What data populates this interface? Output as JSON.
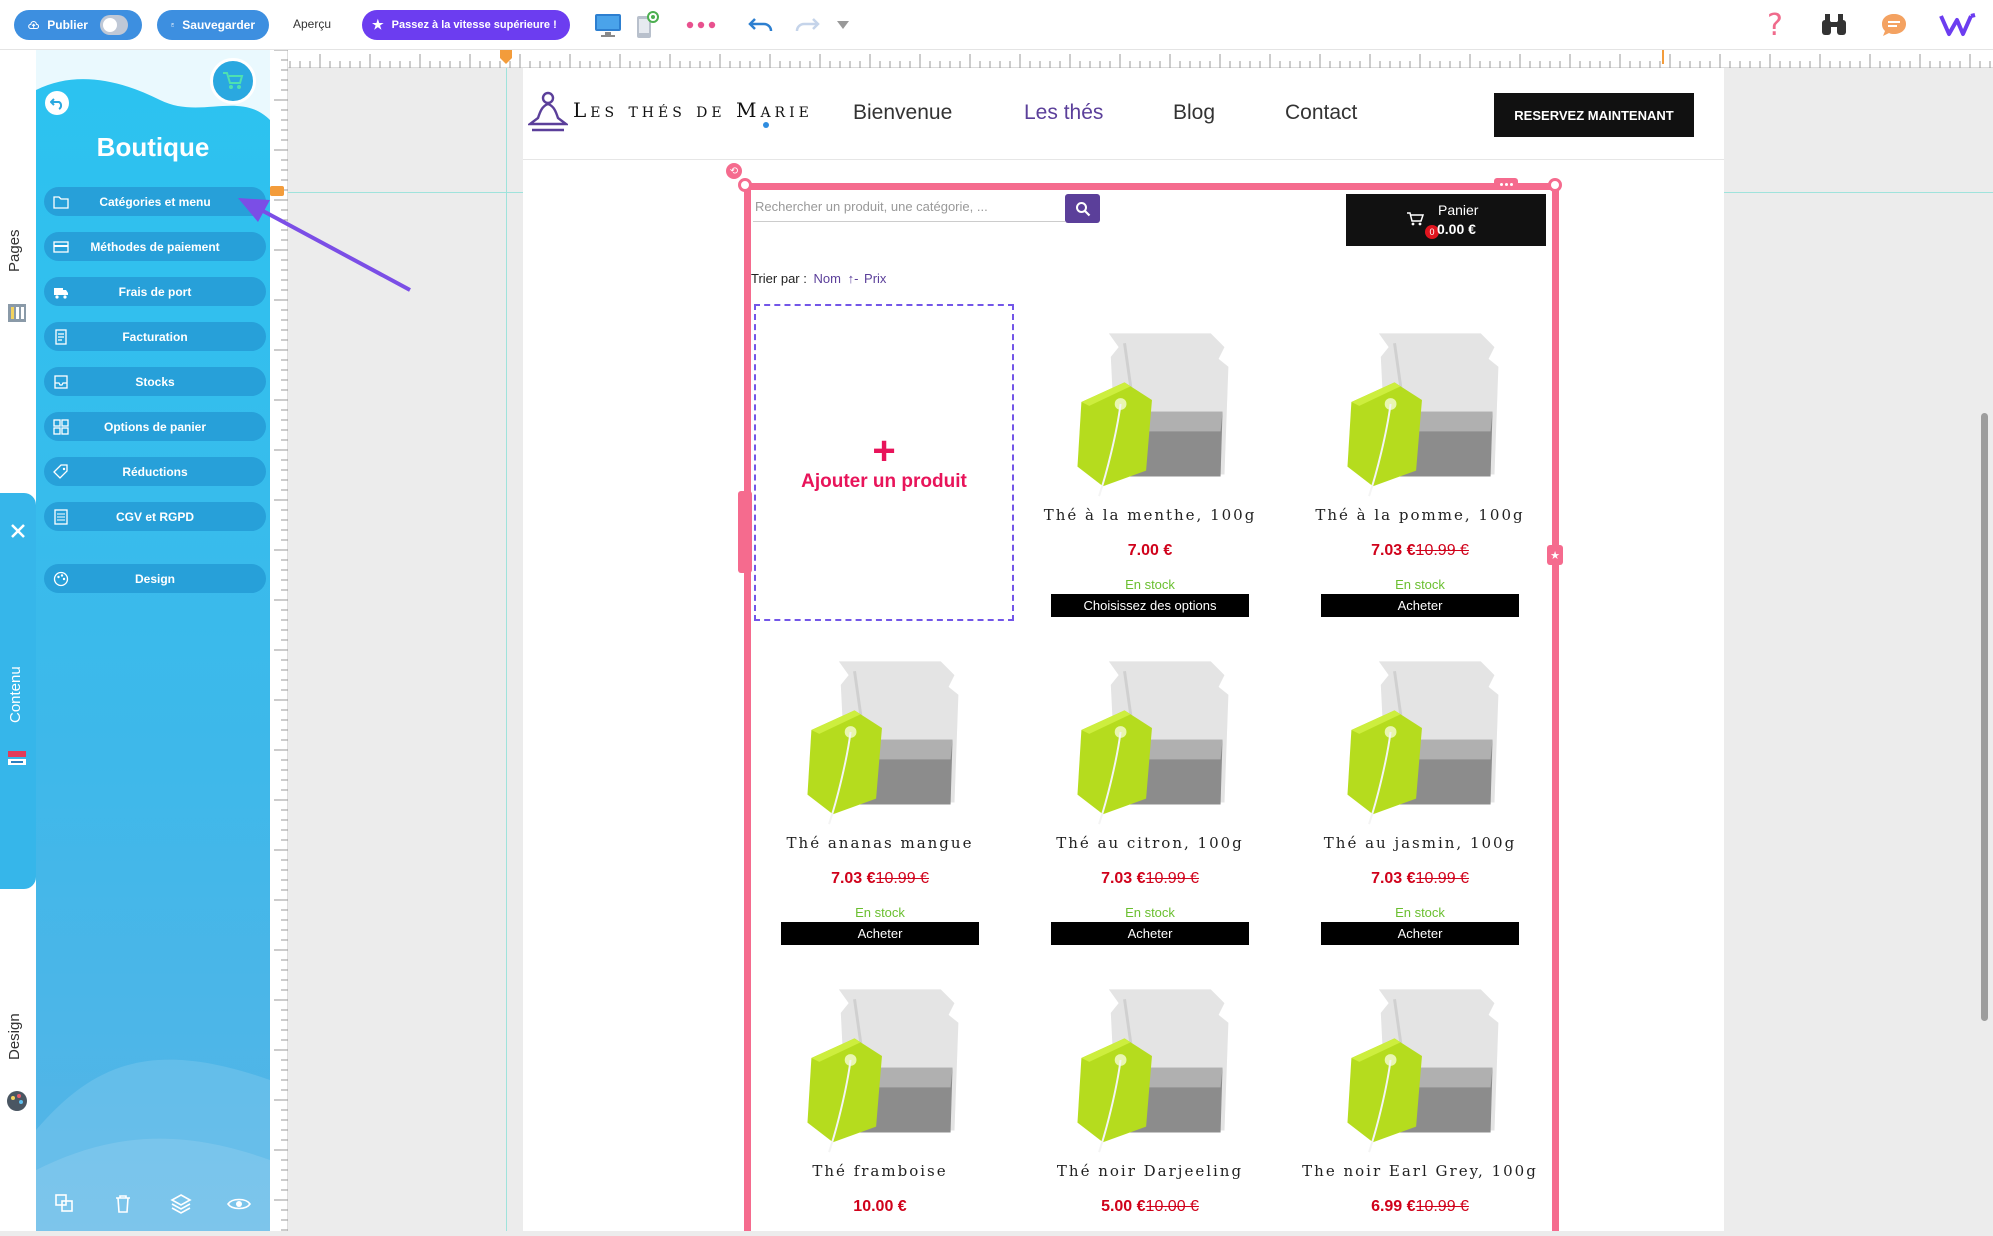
{
  "toolbar": {
    "publish_label": "Publier",
    "save_label": "Sauvegarder",
    "preview_label": "Aperçu",
    "upgrade_label": "Passez à la vitesse supérieure !"
  },
  "rail": {
    "pages_label": "Pages",
    "content_label": "Contenu",
    "design_label": "Design"
  },
  "sidebar": {
    "title": "Boutique",
    "items": [
      {
        "label": "Catégories et menu",
        "icon": "folder-icon"
      },
      {
        "label": "Méthodes de paiement",
        "icon": "credit-card-icon"
      },
      {
        "label": "Frais de port",
        "icon": "truck-icon"
      },
      {
        "label": "Facturation",
        "icon": "invoice-icon"
      },
      {
        "label": "Stocks",
        "icon": "inbox-icon"
      },
      {
        "label": "Options de panier",
        "icon": "grid-icon"
      },
      {
        "label": "Réductions",
        "icon": "tag-icon"
      },
      {
        "label": "CGV et RGPD",
        "icon": "document-icon"
      },
      {
        "label": "Design",
        "icon": "palette-icon"
      }
    ]
  },
  "site": {
    "logo_text": "Les thés de Marie",
    "nav": [
      "Bienvenue",
      "Les thés",
      "Blog",
      "Contact"
    ],
    "cta": "RESERVEZ MAINTENANT"
  },
  "shop": {
    "search_placeholder": "Rechercher un produit, une catégorie, ...",
    "cart_label": "Panier",
    "cart_total": "0.00 €",
    "cart_count": "0",
    "sort_label": "Trier par :",
    "sort_name": "Nom",
    "sort_sep": "↑-",
    "sort_price": "Prix",
    "add_product_label": "Ajouter un produit",
    "products": [
      {
        "name": "Thé à la menthe, 100g",
        "price": "7.00 €",
        "old_price": "",
        "stock": "En stock",
        "button": "Choisissez des options"
      },
      {
        "name": "Thé à la pomme, 100g",
        "price": "7.03 €",
        "old_price": "10.99 €",
        "stock": "En stock",
        "button": "Acheter"
      },
      {
        "name": "Thé ananas mangue",
        "price": "7.03 €",
        "old_price": "10.99 €",
        "stock": "En stock",
        "button": "Acheter"
      },
      {
        "name": "Thé au citron, 100g",
        "price": "7.03 €",
        "old_price": "10.99 €",
        "stock": "En stock",
        "button": "Acheter"
      },
      {
        "name": "Thé au jasmin, 100g",
        "price": "7.03 €",
        "old_price": "10.99 €",
        "stock": "En stock",
        "button": "Acheter"
      },
      {
        "name": "Thé framboise",
        "price": "10.00 €",
        "old_price": "",
        "stock": "",
        "button": ""
      },
      {
        "name": "Thé noir Darjeeling",
        "price": "5.00 €",
        "old_price": "10.00 €",
        "stock": "",
        "button": ""
      },
      {
        "name": "The noir Earl Grey, 100g",
        "price": "6.99 €",
        "old_price": "10.99 €",
        "stock": "",
        "button": ""
      }
    ]
  },
  "colors": {
    "sidebar": "#2bc3f0",
    "frame": "#f56b8e",
    "price": "#d0021b",
    "stock": "#6abf2f",
    "accent": "#6c3df0"
  }
}
